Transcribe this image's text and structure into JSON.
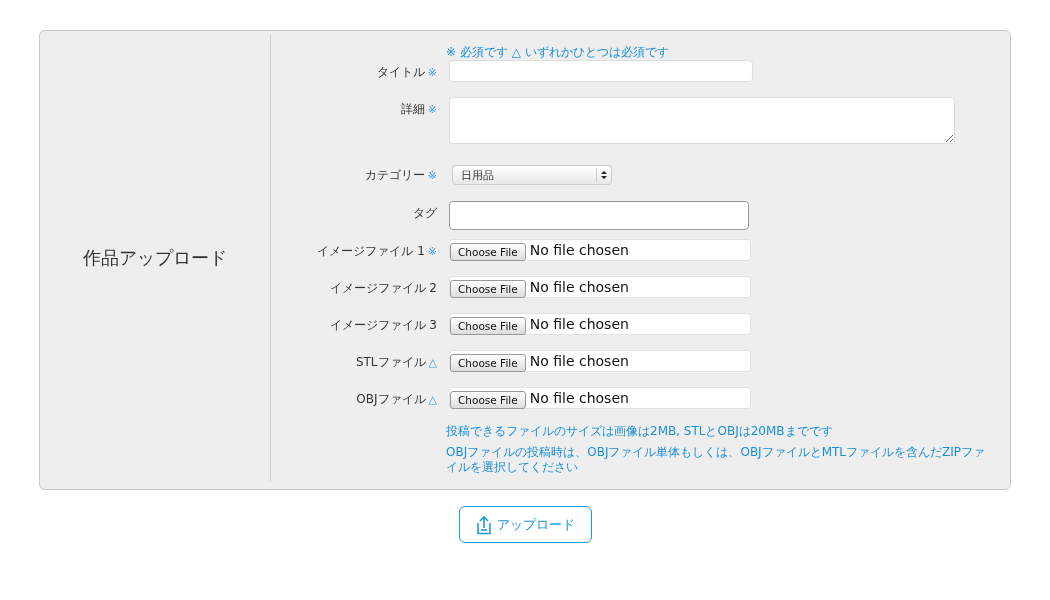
{
  "section_title": "作品アップロード",
  "legend": "※ 必須です △ いずれかひとつは必須です",
  "fields": [
    {
      "kind": "text",
      "label": "タイトル",
      "mark": "※"
    },
    {
      "kind": "textarea",
      "label": "詳細",
      "mark": "※"
    },
    {
      "kind": "select",
      "label": "カテゴリー",
      "mark": "※",
      "value": "日用品"
    },
    {
      "kind": "tag",
      "label": "タグ"
    },
    {
      "kind": "file",
      "label": "イメージファイル 1",
      "mark": "※",
      "button": "Choose File",
      "status": "No file chosen"
    },
    {
      "kind": "file",
      "label": "イメージファイル 2",
      "button": "Choose File",
      "status": "No file chosen"
    },
    {
      "kind": "file",
      "label": "イメージファイル 3",
      "button": "Choose File",
      "status": "No file chosen"
    },
    {
      "kind": "file",
      "label": "STLファイル",
      "mark": "△",
      "button": "Choose File",
      "status": "No file chosen"
    },
    {
      "kind": "file",
      "label": "OBJファイル",
      "mark": "△",
      "button": "Choose File",
      "status": "No file chosen"
    }
  ],
  "notes": [
    "投稿できるファイルのサイズは画像は2MB, STLとOBJは20MBまでです",
    "OBJファイルの投稿時は、OBJファイル単体もしくは、OBJファイルとMTLファイルを含んだZIPファイルを選択してください"
  ],
  "upload_button": "アップロード"
}
